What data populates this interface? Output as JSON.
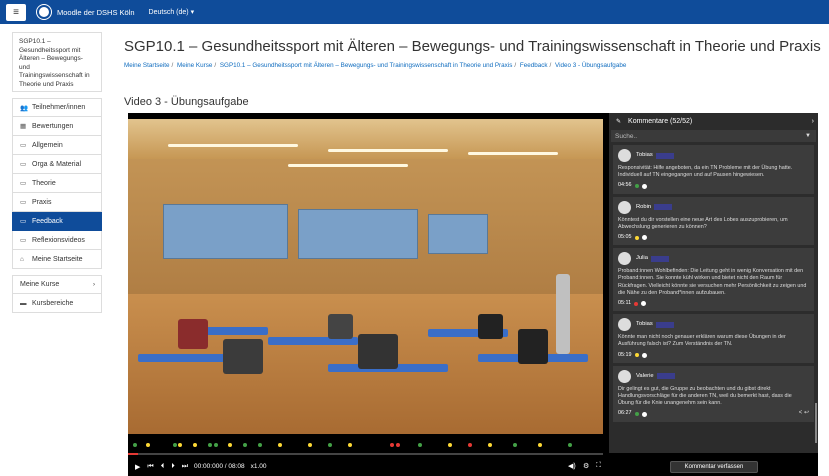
{
  "navbar": {
    "title": "Moodle der DSHS Köln",
    "language": "Deutsch (de) ▾",
    "menu_icon": "hamburger-icon"
  },
  "sidebar": {
    "course": "SGP10.1 – Gesundheitssport mit Älteren – Bewegungs- und Trainingswissenschaft in Theorie und Praxis",
    "items": [
      {
        "label": "Teilnehmer/innen",
        "icon": "users-icon"
      },
      {
        "label": "Bewertungen",
        "icon": "table-icon"
      },
      {
        "label": "Allgemein",
        "icon": "folder-icon"
      },
      {
        "label": "Orga & Material",
        "icon": "folder-icon"
      },
      {
        "label": "Theorie",
        "icon": "folder-icon"
      },
      {
        "label": "Praxis",
        "icon": "folder-icon"
      },
      {
        "label": "Feedback",
        "icon": "folder-icon",
        "active": true
      },
      {
        "label": "Reflexionsvideos",
        "icon": "folder-icon"
      },
      {
        "label": "Meine Startseite",
        "icon": "home-icon"
      }
    ],
    "group2": [
      {
        "label": "Meine Kurse",
        "icon": "",
        "chevron": "›"
      },
      {
        "label": "Kursbereiche",
        "icon": "folder-icon"
      }
    ]
  },
  "header": {
    "title": "SGP10.1 – Gesundheitssport mit Älteren – Bewegungs- und Trainingswissenschaft in Theorie und Praxis",
    "breadcrumb": [
      "Meine Startseite",
      "Meine Kurse",
      "SGP10.1 – Gesundheitssport mit Älteren – Bewegungs- und Trainingswissenschaft in Theorie und Praxis",
      "Feedback",
      "Video 3 - Übungsaufgabe"
    ]
  },
  "section_title": "Video 3 - Übungsaufgabe",
  "player": {
    "time": "00:00:000 / 08:08",
    "rate": "x1.00",
    "progress": 0.02,
    "comment_button": "Kommentar verfassen"
  },
  "comments_panel": {
    "title": "Kommentare (52/52)",
    "search_placeholder": "Suche..",
    "comments": [
      {
        "name": "Tobias",
        "text": "Responsivität: Hilfe angeboten, da ein TN Probleme mit der Übung hatte. Individuell auf TN eingegangen und auf Pausen hingewiesen.",
        "time": "04:56",
        "color": "#43a047"
      },
      {
        "name": "Robin",
        "text": "Könntest du dir vorstellen eine neue Art des Lobes auszuprobieren, um Abwechslung generieren zu können?",
        "time": "05:05",
        "color": "#fdd835"
      },
      {
        "name": "Julia",
        "text": "Proband:innen Wohlbefinden: Die Leitung geht in wenig Konversation mit den Proband:innen. Sie konnte kühl wirken und bietet nicht den Raum für Rückfragen. Vielleicht könnte sie versuchen mehr Persönlichkeit zu zeigen und die Nähe zu den Proband*innen aufzubauen.",
        "time": "05:11",
        "color": "#e53935"
      },
      {
        "name": "Tobias",
        "text": "Könnte man nicht noch genauer erklären warum diese Übungen in der Ausführung falsch ist? Zum Verständnis der TN.",
        "time": "05:19",
        "color": "#fdd835"
      },
      {
        "name": "Valerie",
        "text": "Dir gelingt es gut, die Gruppe zu beobachten und du gibst direkt Handlungsvorschläge für die anderen TN, weil du bemerkt hast, dass die Übung für die Knie unangenehm sein kann.",
        "time": "06:27",
        "color": "#43a047"
      }
    ]
  }
}
